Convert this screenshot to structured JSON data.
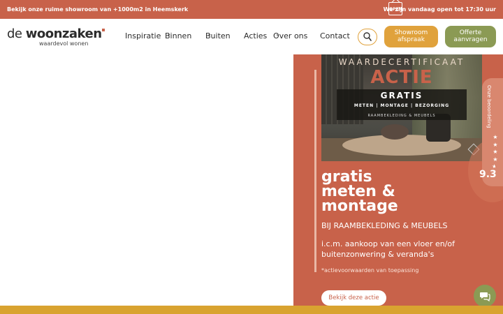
{
  "topbar": {
    "left_text": "Bekijk onze ruime showroom van +1000m2 in Heemskerk",
    "open_icon_label": "OPEN",
    "right_text": "We zijn vandaag open tot 17:30 uur"
  },
  "header": {
    "logo": {
      "de": "de ",
      "main": "woonzaken",
      "tagline": "waardevol wonen"
    },
    "nav": [
      {
        "label": "Inspiratie",
        "has_dropdown": false
      },
      {
        "label": "Binnen",
        "has_dropdown": true
      },
      {
        "label": "Buiten",
        "has_dropdown": true
      },
      {
        "label": "Acties",
        "has_dropdown": false
      },
      {
        "label": "Over ons",
        "has_dropdown": true
      },
      {
        "label": "Contact",
        "has_dropdown": false
      }
    ],
    "chevron": "⌄",
    "showroom_button": "Showroom afspraak",
    "offerte_button": "Offerte aanvragen"
  },
  "promo": {
    "photo": {
      "certificate_text": "WAARDECERTIFICAAT",
      "actie_text": "ACTIE",
      "gratis_text": "GRATIS",
      "services_text": "METEN | MONTAGE | BEZORGING",
      "category_text": "RAAMBEKLEDING & MEUBELS"
    },
    "headline_line1": "gratis",
    "headline_line2": "meten &",
    "headline_line3": "montage",
    "subtitle": "BIJ RAAMBEKLEDING & MEUBELS",
    "description": "i.c.m. aankoop van een vloer en/of buitenzonwering & veranda's",
    "note": "*actievoorwaarden van toepassing",
    "cta": "Bekijk deze actie"
  },
  "rating": {
    "label": "Onze beoordeling",
    "stars": 4.5,
    "star_glyph": "★",
    "score": "9.3"
  },
  "colors": {
    "topbar": "#c8624a",
    "accent_orange": "#e0a23c",
    "accent_green": "#8b9a54",
    "promo_bg": "#c8624a"
  },
  "icons": {
    "search": "search-icon",
    "chat": "chat-icon",
    "open_sign": "open-sign-icon"
  }
}
